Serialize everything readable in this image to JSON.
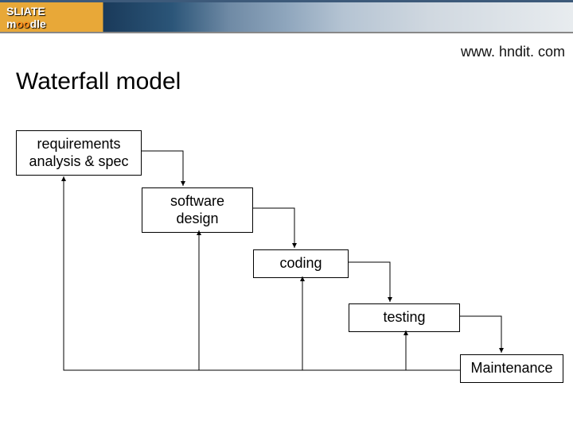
{
  "banner": {
    "logo_prefix": "SLIATE",
    "logo_brand_start": "m",
    "logo_brand_mid": "oo",
    "logo_brand_end": "dle"
  },
  "url": "www. hndit. com",
  "title": "Waterfall model",
  "stages": {
    "s0": "requirements\nanalysis & spec",
    "s1": "software\ndesign",
    "s2": "coding",
    "s3": "testing",
    "s4": "Maintenance"
  }
}
